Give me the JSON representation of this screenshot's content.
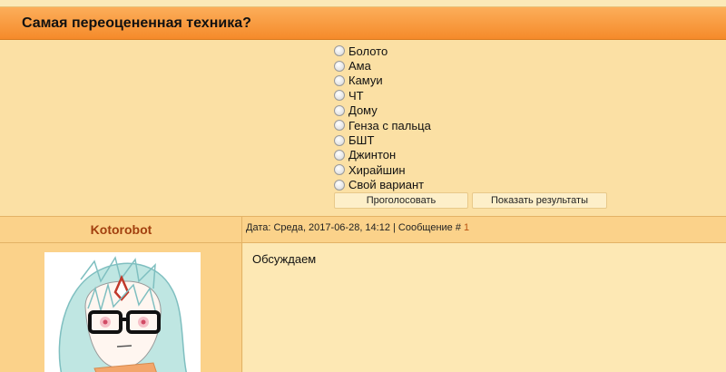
{
  "poll": {
    "title": "Самая переоцененная техника?",
    "options": [
      "Болото",
      "Ама",
      "Камуи",
      "ЧТ",
      "Дому",
      "Генза с пальца",
      "БШТ",
      "Джинтон",
      "Хирайшин",
      "Свой вариант"
    ],
    "vote_label": "Проголосовать",
    "results_label": "Показать результаты"
  },
  "post": {
    "author": "Kotorobot",
    "meta_prefix": "Дата: Среда, 2017-06-28, 14:12 | Сообщение # ",
    "message_number": "1",
    "text": "Обсуждаем"
  },
  "colors": {
    "header_gradient_top": "#fcae5a",
    "header_gradient_bottom": "#f58a2a",
    "author": "#a2400f",
    "page_bg": "#fbe3a8"
  },
  "icons": [
    "radio-icon"
  ]
}
